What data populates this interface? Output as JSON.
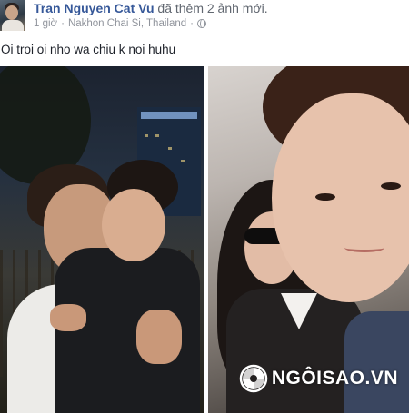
{
  "post": {
    "author": "Tran Nguyen Cat Vu",
    "action": "đã thêm 2 ảnh mới.",
    "time": "1 giờ",
    "separator": "·",
    "location": "Nakhon Chai Si, Thailand",
    "privacy_icon": "globe-icon",
    "text": "Oi troi oi nho wa chiu k noi huhu"
  },
  "photos": [
    {
      "description_icon": "photo",
      "building_sign": ""
    },
    {
      "description_icon": "photo"
    }
  ],
  "watermark": {
    "text": "NGÔISAO.VN",
    "logo_icon": "swirl-logo-icon"
  },
  "colors": {
    "author_link": "#365899",
    "meta": "#90949c",
    "body_text": "#1d2129"
  }
}
